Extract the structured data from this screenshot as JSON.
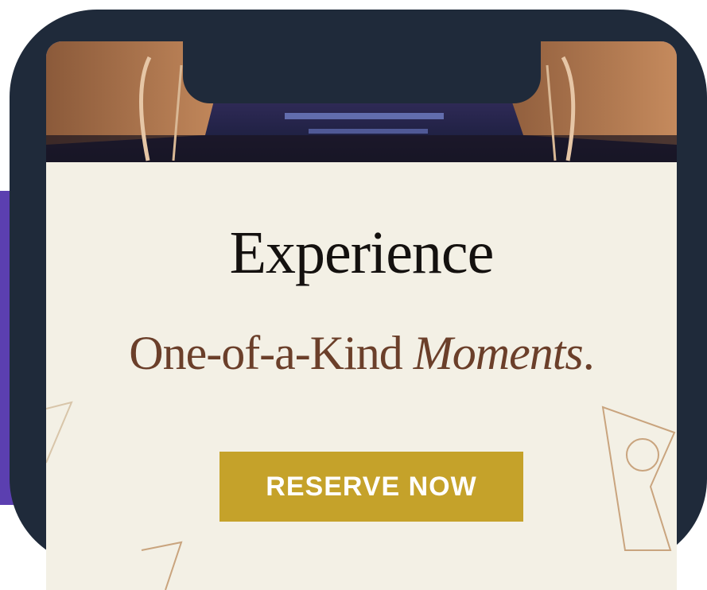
{
  "promo": {
    "headline": "Experience",
    "tagline_plain": "One-of-a-Kind ",
    "tagline_italic": "Moments",
    "tagline_end": ".",
    "cta_label": "RESERVE NOW"
  },
  "colors": {
    "phone_frame": "#1f2a3a",
    "screen_bg": "#f3f0e5",
    "headline": "#14110f",
    "tagline": "#6b3f2a",
    "cta_bg": "#c5a22a",
    "cta_text": "#ffffff",
    "accent_purple": "#5b3fb0"
  }
}
